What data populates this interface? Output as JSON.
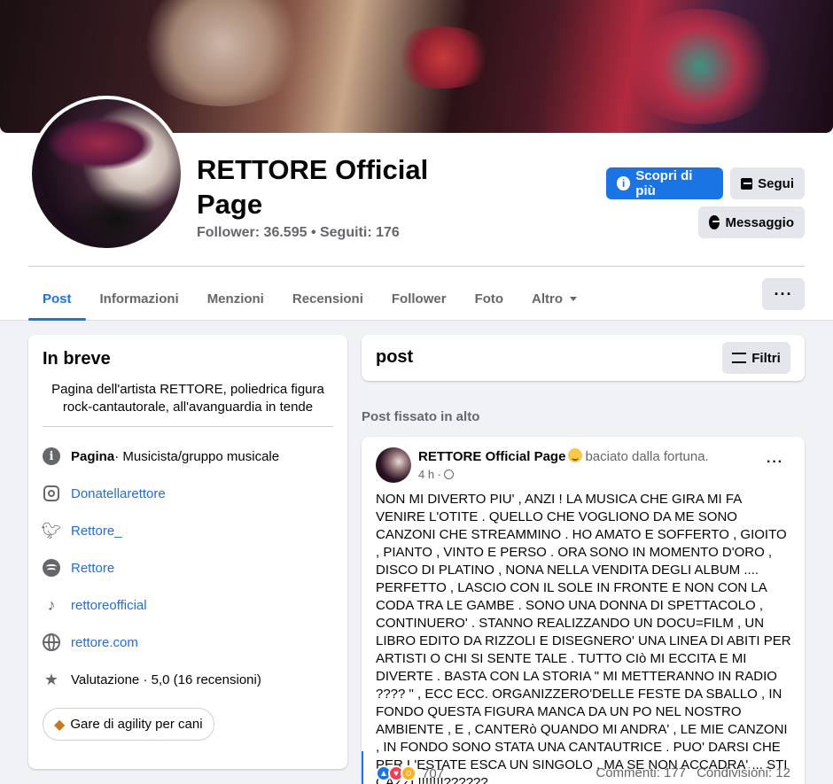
{
  "page": {
    "name": "RETTORE Official Page",
    "followers": "Follower: 36.595 • Seguiti: 176"
  },
  "actions": {
    "learn_more": "Scopri di più",
    "follow": "Segui",
    "message": "Messaggio"
  },
  "tabs": [
    {
      "label": "Post",
      "active": true
    },
    {
      "label": "Informazioni"
    },
    {
      "label": "Menzioni"
    },
    {
      "label": "Recensioni"
    },
    {
      "label": "Follower"
    },
    {
      "label": "Foto"
    },
    {
      "label": "Altro"
    }
  ],
  "intro": {
    "title": "In breve",
    "bio": "Pagina dell'artista RETTORE, poliedrica figura rock-cantautorale, all'avanguardia in tende",
    "category_label": "Pagina",
    "category": " · Musicista/gruppo musicale",
    "instagram": "Donatellarettore",
    "twitter": "Rettore_",
    "spotify": "Rettore",
    "tiktok": "rettoreofficial",
    "website": "rettore.com",
    "rating": "Valutazione · 5,0 (16 recensioni)",
    "chip": "Gare di agility per cani"
  },
  "posts_header": {
    "title": "post",
    "filter": "Filtri"
  },
  "pinned_label": "Post fissato in alto",
  "post": {
    "author": "RETTORE Official Page",
    "feeling": "baciato dalla fortuna.",
    "time": "4 h ·",
    "text": "NON MI DIVERTO PIU' , ANZI ! LA MUSICA CHE GIRA MI FA VENIRE L'OTITE . QUELLO CHE VOGLIONO DA ME SONO CANZONI CHE STREAMMINO . HO AMATO E SOFFERTO , GIOITO , PIANTO , VINTO E PERSO . ORA SONO IN MOMENTO D'ORO , DISCO DI PLATINO , NONA NELLA VENDITA DEGLI ALBUM .... PERFETTO , LASCIO CON IL SOLE IN FRONTE E NON CON LA CODA TRA LE GAMBE . SONO UNA DONNA DI SPETTACOLO , CONTINUERO' . STANNO REALIZZANDO UN DOCU=FILM , UN LIBRO EDITO DA RIZZOLI E DISEGNERO' UNA LINEA DI ABITI PER ARTISTI O CHI SI SENTE TALE . TUTTO CIò MI ECCITA E MI DIVERTE . BASTA CON LA STORIA \" MI METTERANNO IN RADIO ???? \" , ECC ECC. ORGANIZZERO'DELLE FESTE DA SBALLO , IN FONDO QUESTA FIGURA MANCA DA UN PO NEL NOSTRO AMBIENTE , E , CANTERò QUANDO MI ANDRA' , LE MIE CANZONI , IN FONDO SONO STATA UNA CANTAUTRICE . PUO' DARSI CHE PER L'ESTATE ESCA UN SINGOLO , MA SE NON ACCADRA' ... STI CAZZI !!!!!!!??????",
    "reactions": "707",
    "comments": "Commenti: 177",
    "shares": "Condivisioni: 12"
  },
  "colors": {
    "accent": "#1b74e4",
    "link": "#216fdb",
    "bg": "#f0f2f5"
  }
}
